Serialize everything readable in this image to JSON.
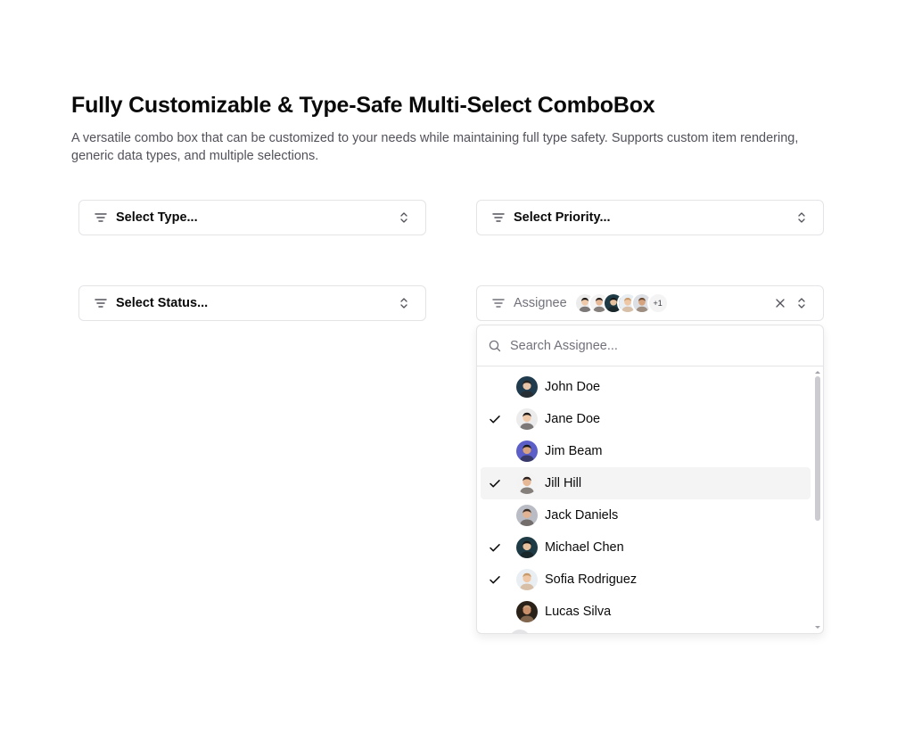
{
  "page": {
    "title": "Fully Customizable & Type-Safe Multi-Select ComboBox",
    "description": "A versatile combo box that can be customized to your needs while maintaining full type safety. Supports custom item rendering, generic data types, and multiple selections."
  },
  "combos": {
    "type_label": "Select Type...",
    "priority_label": "Select Priority...",
    "status_label": "Select Status...",
    "assignee_label": "Assignee",
    "assignee_more": "+1"
  },
  "assignee_popover": {
    "search_placeholder": "Search Assignee...",
    "items": [
      {
        "name": "John Doe",
        "checked": false,
        "highlighted": false,
        "avatar_bg": "#1f3b4d",
        "avatar_skin": "#e8c4a8",
        "avatar_hair": "#2b2420"
      },
      {
        "name": "Jane Doe",
        "checked": true,
        "highlighted": false,
        "avatar_bg": "#ececec",
        "avatar_skin": "#f0c9a8",
        "avatar_hair": "#1f1a17"
      },
      {
        "name": "Jim Beam",
        "checked": false,
        "highlighted": false,
        "avatar_bg": "#5b5fc7",
        "avatar_skin": "#d9a27f",
        "avatar_hair": "#1a1a1a"
      },
      {
        "name": "Jill Hill",
        "checked": true,
        "highlighted": true,
        "avatar_bg": "#f3f3f3",
        "avatar_skin": "#e6b896",
        "avatar_hair": "#2a1f1a"
      },
      {
        "name": "Jack Daniels",
        "checked": false,
        "highlighted": false,
        "avatar_bg": "#b9bcc4",
        "avatar_skin": "#e2b392",
        "avatar_hair": "#3a2d24"
      },
      {
        "name": "Michael Chen",
        "checked": true,
        "highlighted": false,
        "avatar_bg": "#1e3a44",
        "avatar_skin": "#e7c09d",
        "avatar_hair": "#161616"
      },
      {
        "name": "Sofia Rodriguez",
        "checked": true,
        "highlighted": false,
        "avatar_bg": "#e9eef2",
        "avatar_skin": "#efc7a4",
        "avatar_hair": "#c89a6a"
      },
      {
        "name": "Lucas Silva",
        "checked": false,
        "highlighted": false,
        "avatar_bg": "#2a2118",
        "avatar_skin": "#c98f68",
        "avatar_hair": "#c9a07a"
      }
    ],
    "selected_avatars": [
      {
        "avatar_bg": "#ececec",
        "avatar_skin": "#f0c9a8",
        "avatar_hair": "#1f1a17"
      },
      {
        "avatar_bg": "#f3f3f3",
        "avatar_skin": "#e6b896",
        "avatar_hair": "#2a1f1a"
      },
      {
        "avatar_bg": "#1e3a44",
        "avatar_skin": "#e7c09d",
        "avatar_hair": "#161616"
      },
      {
        "avatar_bg": "#e9eef2",
        "avatar_skin": "#efc7a4",
        "avatar_hair": "#c89a6a"
      },
      {
        "avatar_bg": "#dcdfe3",
        "avatar_skin": "#d7a37e",
        "avatar_hair": "#6b4a33"
      }
    ]
  },
  "icons": {
    "filter": "filter-lines-icon",
    "chevrons": "chevron-up-down-icon",
    "clear": "x-icon",
    "search": "search-icon",
    "check": "check-icon"
  }
}
